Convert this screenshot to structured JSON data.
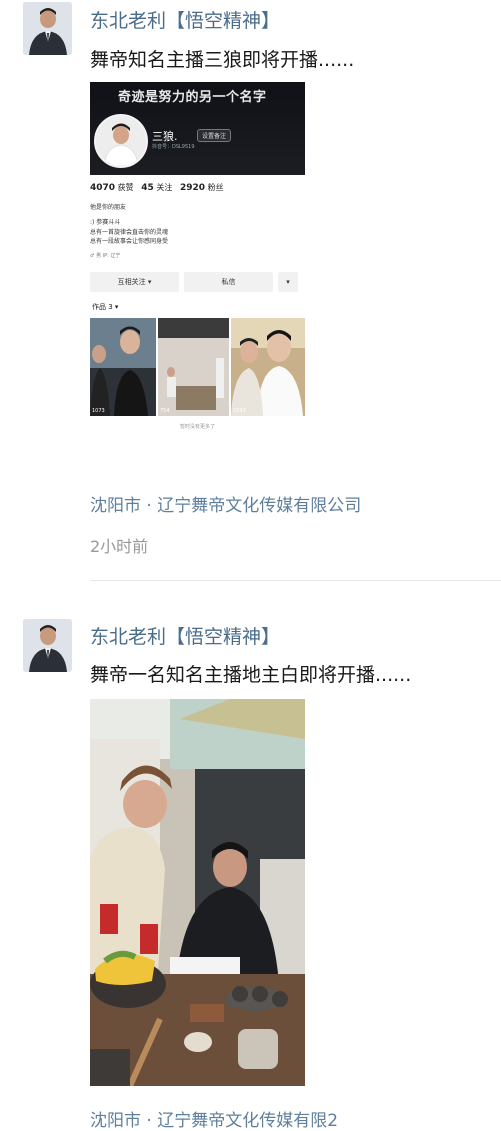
{
  "posts": [
    {
      "author": "东北老利【悟空精神】",
      "text": "舞帝知名主播三狼即将开播......",
      "location": "沈阳市 · 辽宁舞帝文化传媒有限公司",
      "time": "2小时前",
      "profile_shot": {
        "slogan": "奇迹是努力的另一个名字",
        "nickname": "三狼.",
        "remark_button": "设置备注",
        "id_line": "抖音号：DSL9519",
        "stats": [
          {
            "value": "4070",
            "label": "获赞"
          },
          {
            "value": "45",
            "label": "关注"
          },
          {
            "value": "2920",
            "label": "粉丝"
          }
        ],
        "may_know": "他是你的朋友",
        "fans_group": ":) 参赛斗斗",
        "bio_lines": [
          "总有一首旋律会直击你的灵魂",
          "总有一段故事会让你感同身受"
        ],
        "tags": "♂ 男   IP: 辽宁",
        "follow_button": "互相关注 ▾",
        "message_button": "私信",
        "more_button": "▾",
        "works_label": "作品 3 ▾",
        "thumb_likes": [
          "1073",
          "754",
          "2243"
        ],
        "no_more": "暂时没有更多了"
      }
    },
    {
      "author": "东北老利【悟空精神】",
      "text": "舞帝一名知名主播地主白即将开播......",
      "location": "沈阳市 · 辽宁舞帝文化传媒有限2"
    }
  ]
}
